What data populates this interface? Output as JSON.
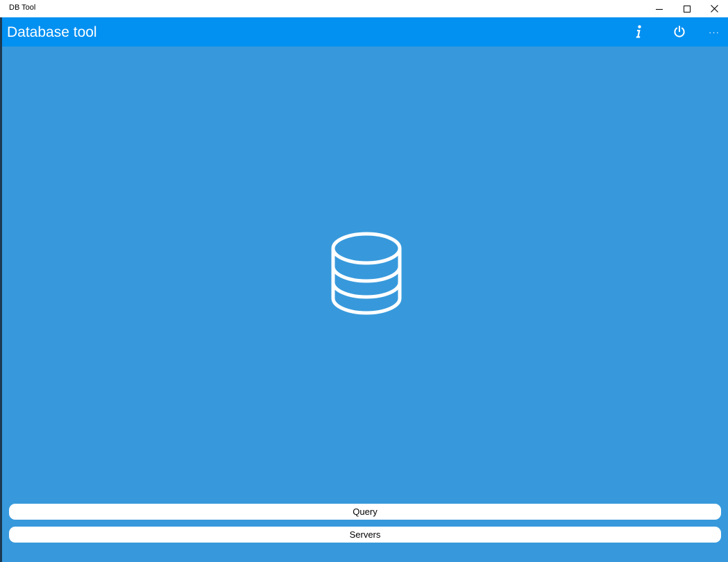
{
  "window": {
    "title": "DB Tool"
  },
  "appbar": {
    "title": "Database tool",
    "icons": [
      "info-icon",
      "power-icon",
      "more-icon"
    ],
    "more_label": "···"
  },
  "main": {
    "logo_icon": "database-icon"
  },
  "buttons": {
    "query_label": "Query",
    "servers_label": "Servers"
  },
  "colors": {
    "titlebar": "#ffffff",
    "appbar": "#0290f1",
    "content": "#3799dc",
    "button": "#ffffff"
  }
}
